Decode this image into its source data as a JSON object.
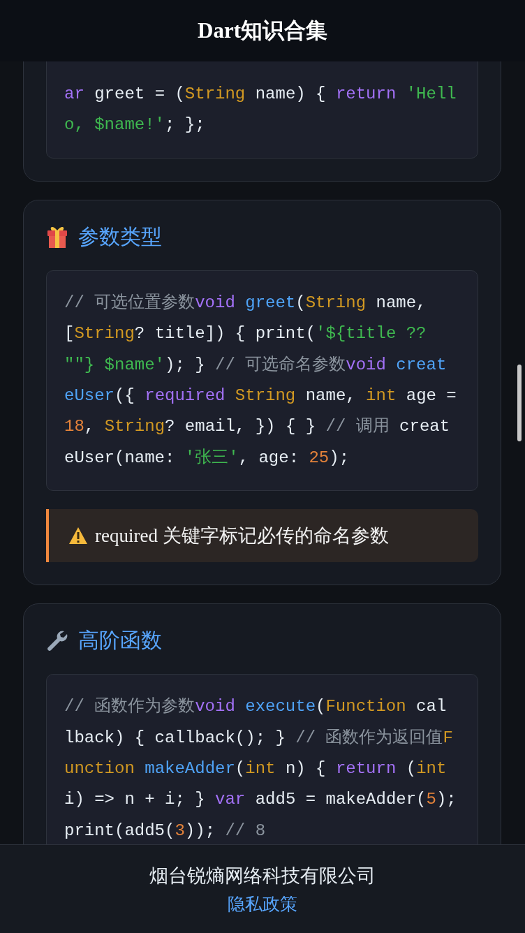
{
  "header": {
    "title": "Dart知识合集"
  },
  "sections": [
    {
      "code": [
        [
          {
            "kind": "keyword",
            "text": "ar"
          },
          {
            "kind": "plain",
            "text": " greet = ("
          },
          {
            "kind": "type",
            "text": "String"
          },
          {
            "kind": "plain",
            "text": " name) { "
          },
          {
            "kind": "keyword",
            "text": "return"
          },
          {
            "kind": "string",
            "text": " 'Hell"
          }
        ],
        [
          {
            "kind": "string",
            "text": "o, $name!'"
          },
          {
            "kind": "plain",
            "text": "; };"
          }
        ]
      ]
    },
    {
      "title": "参数类型",
      "code": [
        [
          {
            "kind": "comment",
            "text": "// 可选位置参数"
          },
          {
            "kind": "keyword",
            "text": "void"
          },
          {
            "kind": "function",
            "text": " greet"
          },
          {
            "kind": "plain",
            "text": "("
          },
          {
            "kind": "type",
            "text": "String"
          },
          {
            "kind": "plain",
            "text": " name,"
          }
        ],
        [
          {
            "kind": "plain",
            "text": "["
          },
          {
            "kind": "type",
            "text": "String"
          },
          {
            "kind": "plain",
            "text": "? title]) { print("
          },
          {
            "kind": "string",
            "text": "'${title ??"
          }
        ],
        [
          {
            "kind": "string",
            "text": "\"\"} $name'"
          },
          {
            "kind": "plain",
            "text": "); } "
          },
          {
            "kind": "comment",
            "text": "// 可选命名参数"
          },
          {
            "kind": "keyword",
            "text": "void"
          },
          {
            "kind": "function",
            "text": " creat"
          }
        ],
        [
          {
            "kind": "function",
            "text": "eUser"
          },
          {
            "kind": "plain",
            "text": "({ "
          },
          {
            "kind": "keyword",
            "text": "required"
          },
          {
            "kind": "type",
            "text": " String"
          },
          {
            "kind": "plain",
            "text": " name, "
          },
          {
            "kind": "type",
            "text": "int"
          },
          {
            "kind": "plain",
            "text": " age ="
          }
        ],
        [
          {
            "kind": "number",
            "text": "18"
          },
          {
            "kind": "plain",
            "text": ", "
          },
          {
            "kind": "type",
            "text": "String"
          },
          {
            "kind": "plain",
            "text": "? email, }) { } "
          },
          {
            "kind": "comment",
            "text": "// 调用"
          },
          {
            "kind": "plain",
            "text": " creat"
          }
        ],
        [
          {
            "kind": "plain",
            "text": "eUser(name: "
          },
          {
            "kind": "string",
            "text": "'张三'"
          },
          {
            "kind": "plain",
            "text": ", age: "
          },
          {
            "kind": "number",
            "text": "25"
          },
          {
            "kind": "plain",
            "text": ");"
          }
        ]
      ],
      "note": "required 关键字标记必传的命名参数"
    },
    {
      "title": "高阶函数",
      "code": [
        [
          {
            "kind": "comment",
            "text": "// 函数作为参数"
          },
          {
            "kind": "keyword",
            "text": "void"
          },
          {
            "kind": "function",
            "text": " execute"
          },
          {
            "kind": "plain",
            "text": "("
          },
          {
            "kind": "type",
            "text": "Function"
          },
          {
            "kind": "plain",
            "text": " cal"
          }
        ],
        [
          {
            "kind": "plain",
            "text": "lback) { callback(); } "
          },
          {
            "kind": "comment",
            "text": "// 函数作为返回值"
          },
          {
            "kind": "type",
            "text": "F"
          }
        ],
        [
          {
            "kind": "type",
            "text": "unction"
          },
          {
            "kind": "function",
            "text": " makeAdder"
          },
          {
            "kind": "plain",
            "text": "("
          },
          {
            "kind": "type",
            "text": "int"
          },
          {
            "kind": "plain",
            "text": " n) { "
          },
          {
            "kind": "keyword",
            "text": "return"
          },
          {
            "kind": "plain",
            "text": " ("
          },
          {
            "kind": "type",
            "text": "int"
          }
        ],
        [
          {
            "kind": "plain",
            "text": "i) => n + i; } "
          },
          {
            "kind": "keyword",
            "text": "var"
          },
          {
            "kind": "plain",
            "text": " add5 = makeAdder("
          },
          {
            "kind": "number",
            "text": "5"
          },
          {
            "kind": "plain",
            "text": ");"
          }
        ],
        [
          {
            "kind": "plain",
            "text": "print(add5("
          },
          {
            "kind": "number",
            "text": "3"
          },
          {
            "kind": "plain",
            "text": ")); "
          },
          {
            "kind": "comment",
            "text": "// 8"
          }
        ]
      ]
    }
  ],
  "footer": {
    "company": "烟台锐熵网络科技有限公司",
    "link": "隐私政策"
  }
}
